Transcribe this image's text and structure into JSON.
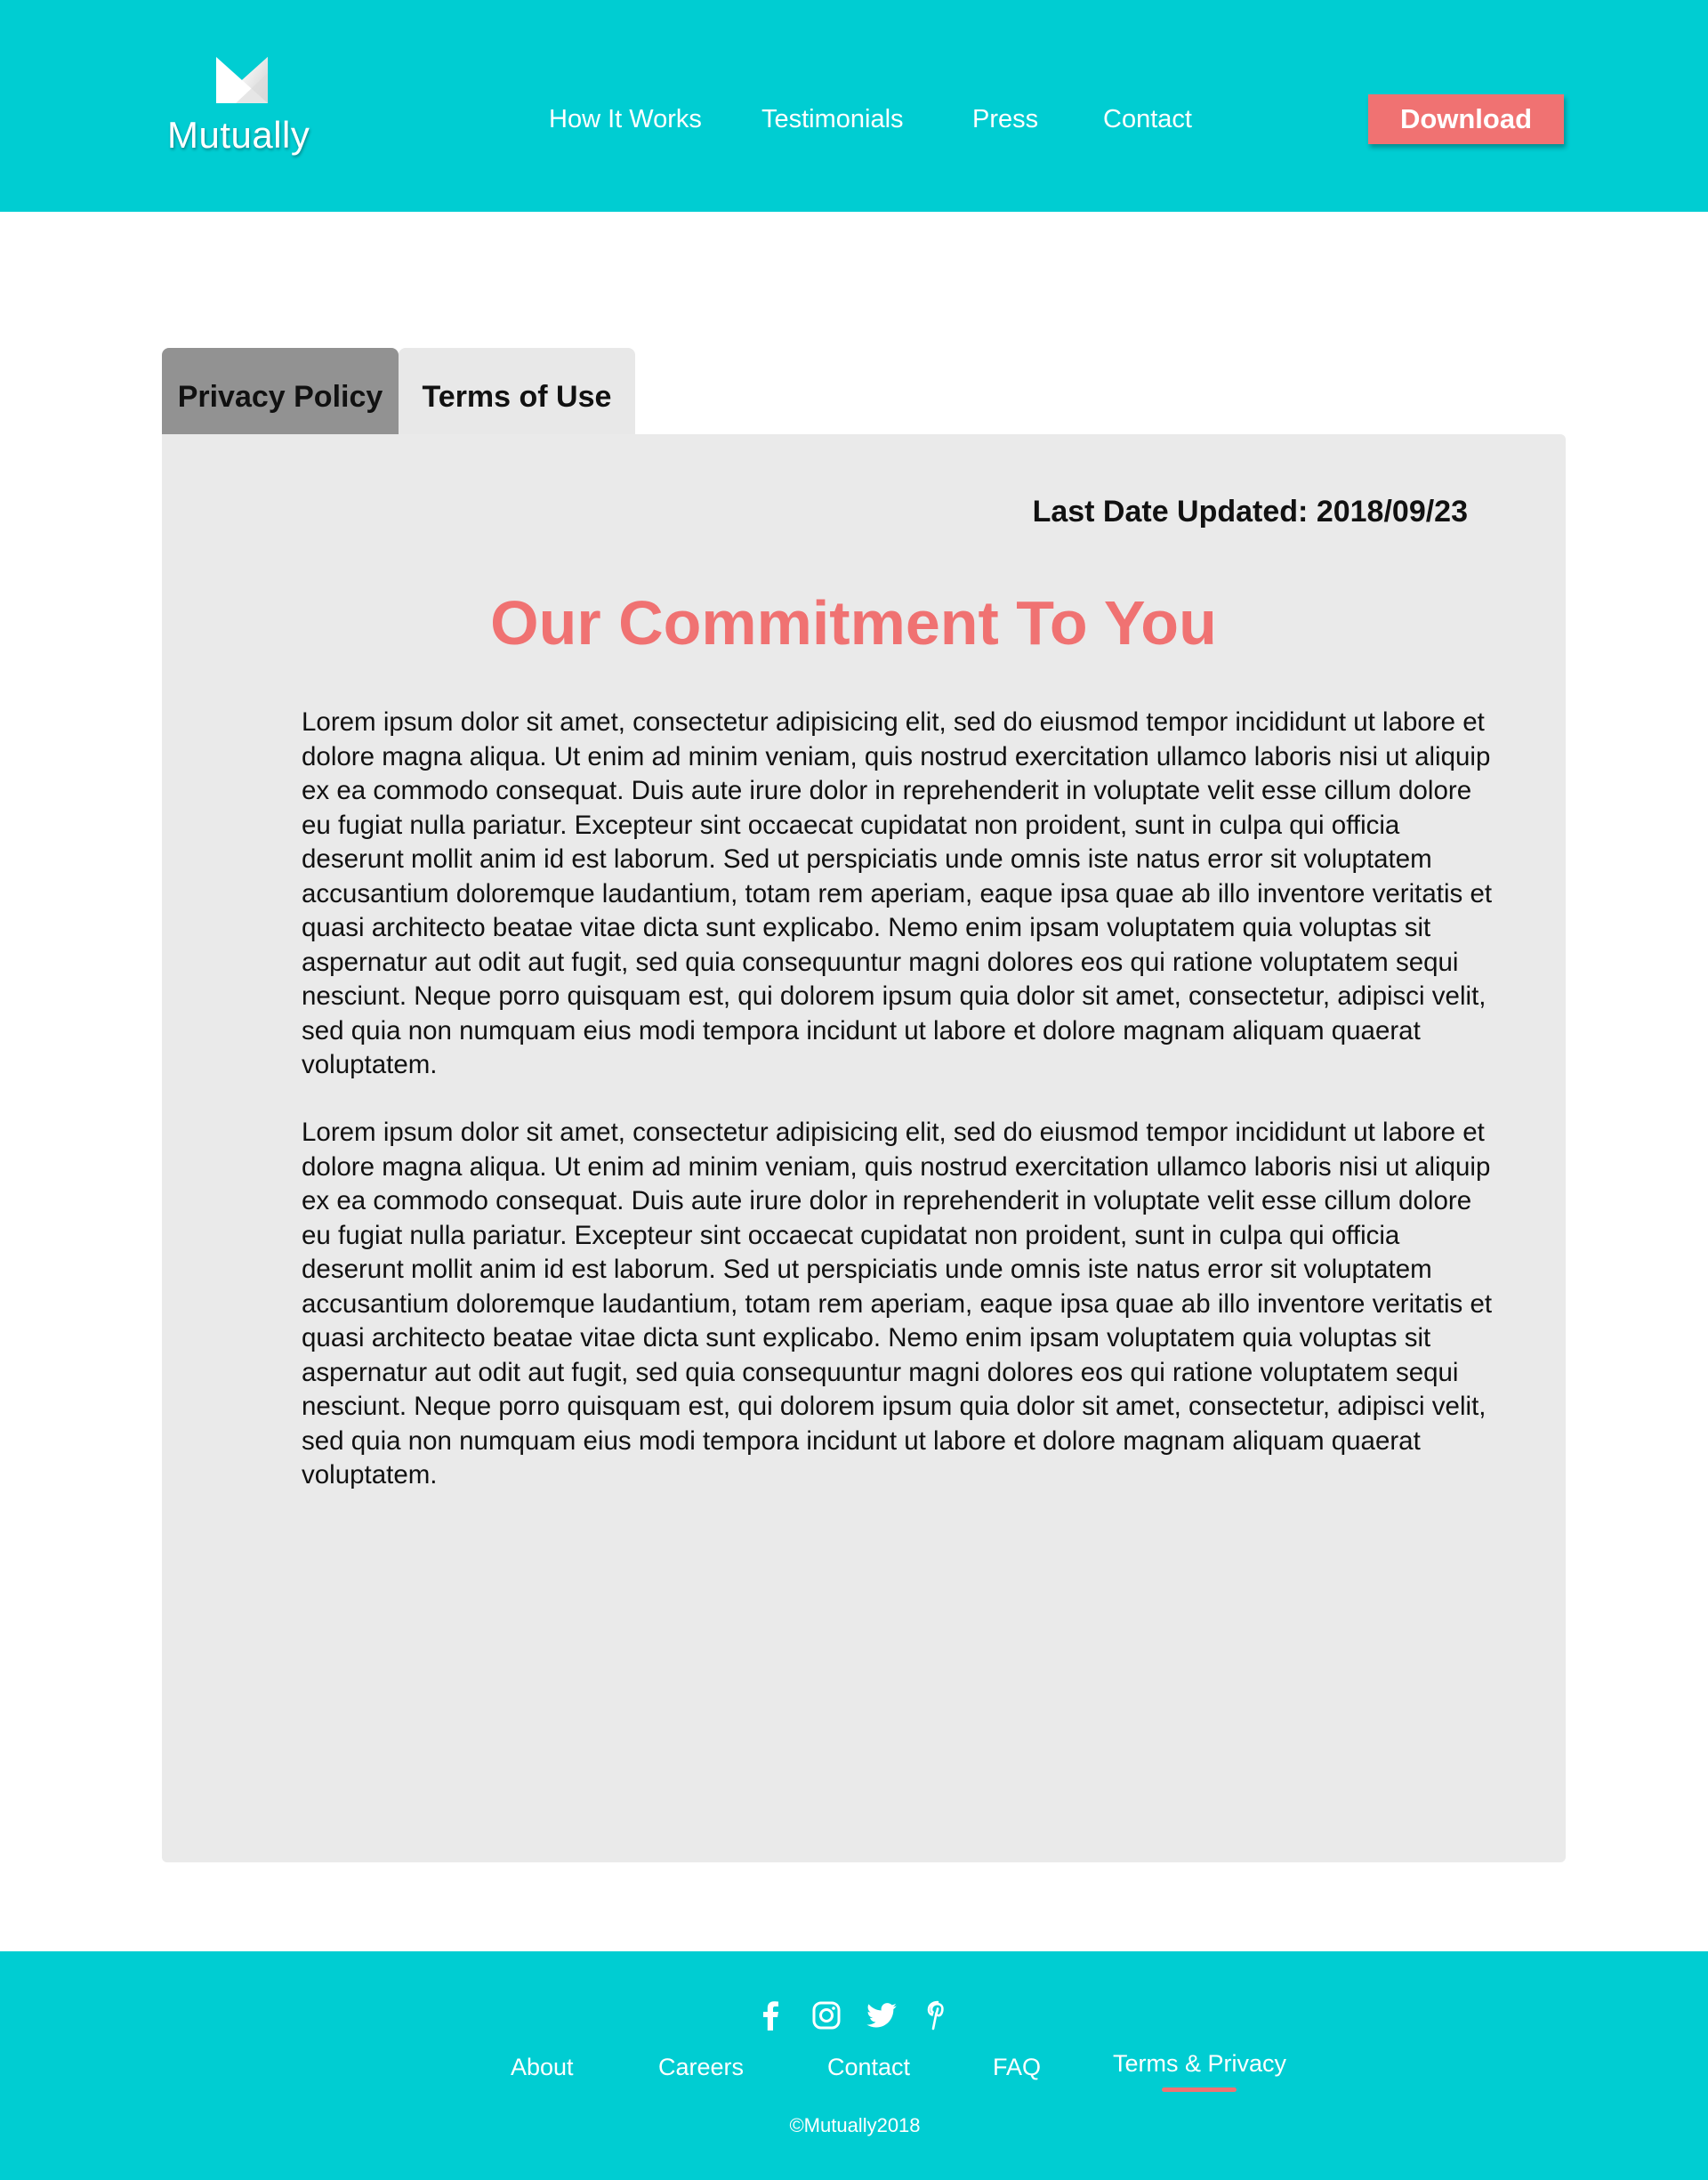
{
  "brand": {
    "name": "Mutually",
    "colors": {
      "teal": "#00cdd2",
      "coral": "#f07272",
      "panel": "#eaeaea",
      "active_tab": "#929292"
    }
  },
  "nav": {
    "items": [
      {
        "label": "How It Works"
      },
      {
        "label": "Testimonials"
      },
      {
        "label": "Press"
      },
      {
        "label": "Contact"
      }
    ],
    "download_label": "Download"
  },
  "tabs": [
    {
      "label": "Privacy Policy",
      "active": true
    },
    {
      "label": "Terms of Use",
      "active": false
    }
  ],
  "content": {
    "last_updated": "Last Date Updated: 2018/09/23",
    "title": "Our Commitment To You",
    "paragraphs": [
      "Lorem ipsum dolor sit amet, consectetur adipisicing elit, sed do eiusmod tempor incididunt ut labore et dolore magna aliqua. Ut enim ad minim veniam, quis nostrud exercitation ullamco laboris nisi ut aliquip ex ea commodo consequat. Duis aute irure dolor in reprehenderit in voluptate velit esse cillum dolore eu fugiat nulla pariatur. Excepteur sint occaecat cupidatat non proident, sunt in culpa qui officia deserunt mollit anim id est laborum. Sed ut perspiciatis unde omnis iste natus error sit voluptatem accusantium doloremque laudantium, totam rem aperiam, eaque ipsa quae ab illo inventore veritatis et quasi architecto beatae vitae dicta sunt explicabo. Nemo enim ipsam voluptatem quia voluptas sit aspernatur aut odit aut fugit, sed quia consequuntur magni dolores eos qui ratione voluptatem sequi nesciunt. Neque porro quisquam est, qui dolorem ipsum quia dolor sit amet, consectetur, adipisci velit, sed quia non numquam eius modi tempora incidunt ut labore et dolore magnam aliquam quaerat voluptatem.",
      "Lorem ipsum dolor sit amet, consectetur adipisicing elit, sed do eiusmod tempor incididunt ut labore et dolore magna aliqua. Ut enim ad minim veniam, quis nostrud exercitation ullamco laboris nisi ut aliquip ex ea commodo consequat. Duis aute irure dolor in reprehenderit in voluptate velit esse cillum dolore eu fugiat nulla pariatur. Excepteur sint occaecat cupidatat non proident, sunt in culpa qui officia deserunt mollit anim id est laborum. Sed ut perspiciatis unde omnis iste natus error sit voluptatem accusantium doloremque laudantium, totam rem aperiam, eaque ipsa quae ab illo inventore veritatis et quasi architecto beatae vitae dicta sunt explicabo. Nemo enim ipsam voluptatem quia voluptas sit aspernatur aut odit aut fugit, sed quia consequuntur magni dolores eos qui ratione voluptatem sequi nesciunt. Neque porro quisquam est, qui dolorem ipsum quia dolor sit amet, consectetur, adipisci velit, sed quia non numquam eius modi tempora incidunt ut labore et dolore magnam aliquam quaerat voluptatem."
    ]
  },
  "footer": {
    "social_icons": [
      "facebook-icon",
      "instagram-icon",
      "twitter-icon",
      "pinterest-icon"
    ],
    "links": [
      {
        "label": "About"
      },
      {
        "label": "Careers"
      },
      {
        "label": "Contact"
      },
      {
        "label": "FAQ"
      },
      {
        "label": "Terms & Privacy",
        "active": true
      }
    ],
    "copyright": "©Mutually2018"
  }
}
